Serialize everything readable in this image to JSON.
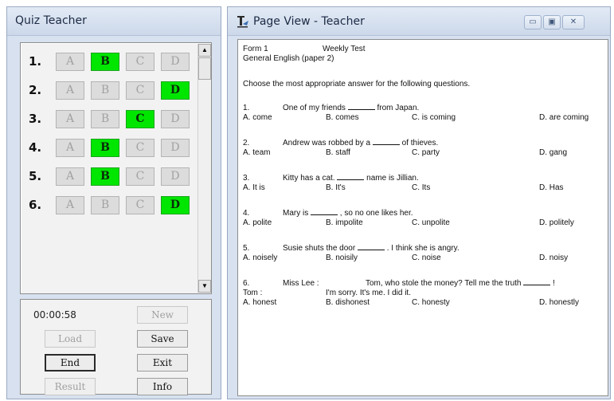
{
  "quiz_window": {
    "title": "Quiz Teacher",
    "questions": [
      {
        "number": "1.",
        "options": [
          "A",
          "B",
          "C",
          "D"
        ],
        "selected": "B"
      },
      {
        "number": "2.",
        "options": [
          "A",
          "B",
          "C",
          "D"
        ],
        "selected": "D"
      },
      {
        "number": "3.",
        "options": [
          "A",
          "B",
          "C",
          "D"
        ],
        "selected": "C"
      },
      {
        "number": "4.",
        "options": [
          "A",
          "B",
          "C",
          "D"
        ],
        "selected": "B"
      },
      {
        "number": "5.",
        "options": [
          "A",
          "B",
          "C",
          "D"
        ],
        "selected": "B"
      },
      {
        "number": "6.",
        "options": [
          "A",
          "B",
          "C",
          "D"
        ],
        "selected": "D"
      }
    ],
    "timer": "00:00:58",
    "buttons": {
      "new": "New",
      "load": "Load",
      "save": "Save",
      "end": "End",
      "exit": "Exit",
      "result": "Result",
      "info": "Info"
    },
    "colors": {
      "selected": "#00e600",
      "unselected": "#dcdcdc"
    }
  },
  "page_window": {
    "title": "Page View - Teacher",
    "paper": {
      "form": "Form 1",
      "test_name": "Weekly Test",
      "subject": "General English (paper 2)",
      "instruction": "Choose the most appropriate answer for the following questions.",
      "questions": [
        {
          "number": "1.",
          "stem_before": "One of my friends",
          "stem_after": "from Japan.",
          "answers": [
            "A. come",
            "B. comes",
            "C. is coming",
            "D. are coming"
          ]
        },
        {
          "number": "2.",
          "stem_before": "Andrew was robbed by a",
          "stem_after": "of thieves.",
          "answers": [
            "A. team",
            "B. staff",
            "C. party",
            "D. gang"
          ]
        },
        {
          "number": "3.",
          "stem_before": "Kitty has a cat.",
          "stem_after": "name is Jillian.",
          "answers": [
            "A. It is",
            "B. It's",
            "C. Its",
            "D. Has"
          ]
        },
        {
          "number": "4.",
          "stem_before": "Mary is",
          "stem_after": ", so no one likes her.",
          "answers": [
            "A. polite",
            "B. impolite",
            "C. unpolite",
            "D. politely"
          ]
        },
        {
          "number": "5.",
          "stem_before": "Susie shuts the door",
          "stem_after": ". I think she is angry.",
          "answers": [
            "A. noisely",
            "B. noisily",
            "C. noise",
            "D. noisy"
          ]
        },
        {
          "number": "6.",
          "speaker_1": "Miss Lee :",
          "line_1": "Tom, who stole the money? Tell me the truth",
          "line_1_end": "!",
          "speaker_2": "Tom :",
          "line_2": "I'm sorry. It's me. I did it.",
          "answers": [
            "A. honest",
            "B. dishonest",
            "C. honesty",
            "D. honestly"
          ]
        }
      ]
    }
  }
}
